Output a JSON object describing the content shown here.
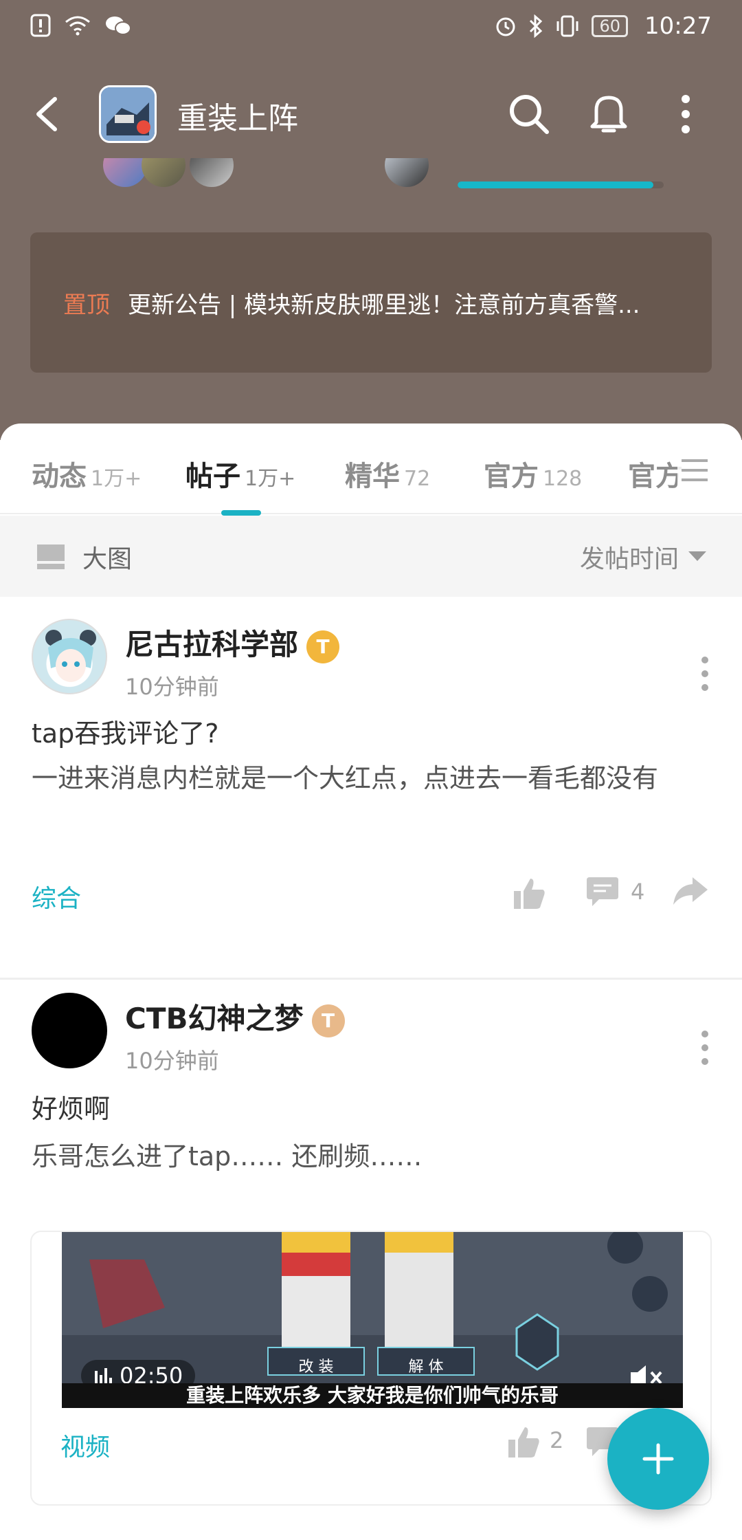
{
  "status_bar": {
    "time": "10:27",
    "battery": "60"
  },
  "header": {
    "title": "重装上阵"
  },
  "community": {
    "progress": 0.95
  },
  "pinned": {
    "tag": "置顶",
    "text": "更新公告 | 模块新皮肤哪里逃！注意前方真香警..."
  },
  "tabs": [
    {
      "label": "动态",
      "count": "1万+"
    },
    {
      "label": "帖子",
      "count": "1万+"
    },
    {
      "label": "精华",
      "count": "72"
    },
    {
      "label": "官方",
      "count": "128"
    },
    {
      "label": "官方",
      "count": ""
    }
  ],
  "filter": {
    "view_label": "大图",
    "sort_label": "发帖时间"
  },
  "posts": [
    {
      "author": "尼古拉科学部",
      "level_badge": "T",
      "time": "10分钟前",
      "title": "tap吞我评论了?",
      "body": "一进来消息内栏就是一个大红点，点进去一看毛都没有",
      "tag": "综合",
      "comments": "4"
    },
    {
      "author": "CTB幻神之梦",
      "level_badge": "T",
      "time": "10分钟前",
      "title": "好烦啊",
      "body": "乐哥怎么进了tap…… 还刷频……",
      "video": {
        "duration": "02:50",
        "subtitle": "重装上阵欢乐多 大家好我是你们帅气的乐哥",
        "btn_left": "改 装",
        "btn_right": "解 体"
      },
      "tag": "视频",
      "likes": "2"
    }
  ],
  "colors": {
    "accent": "#1bb2c4",
    "header_bg": "#7a6b64",
    "pin_tag": "#ec7b53"
  }
}
